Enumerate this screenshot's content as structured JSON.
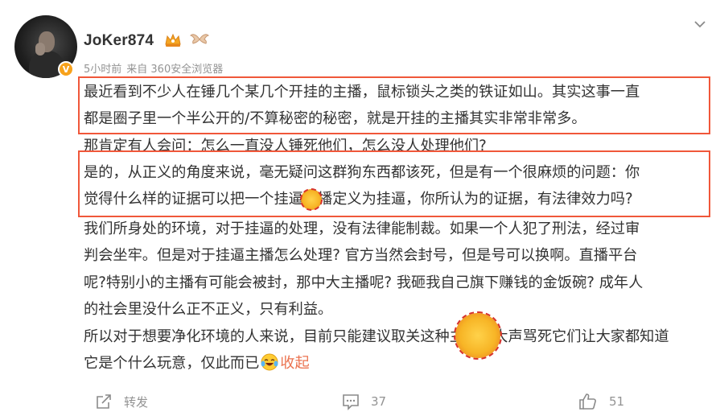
{
  "post": {
    "author": {
      "name": "JoKer874",
      "verified_badge": "V",
      "badges": [
        "crown-icon",
        "wing-icon"
      ]
    },
    "meta": {
      "time": "5小时前",
      "source": "来自 360安全浏览器"
    },
    "paragraphs": [
      "最近看到不少人在锤几个某几个开挂的主播，鼠标锁头之类的铁证如山。其实这事一直",
      "都是圈子里一个半公开的/不算秘密的秘密，就是开挂的主播其实非常非常多。",
      "那肯定有人会问：怎么一直没人锤死他们，怎么没人处理他们?",
      "是的，从正义的角度来说，毫无疑问这群狗东西都该死，但是有一个很麻烦的问题：你",
      "觉得什么样的证据可以把一个挂逼主播定义为挂逼，你所认为的证据，有法律效力吗?",
      "我们所身处的环境，对于挂逼的处理，没有法律能制裁。如果一个人犯了刑法，经过审",
      "判会坐牢。但是对于挂逼主播怎么处理?  官方当然会封号，但是号可以换啊。直播平台",
      "呢?特别小的主播有可能会被封，那中大主播呢?  我砸我自己旗下赚钱的金饭碗?  成年人",
      "的社会里没什么正不正义，只有利益。",
      "所以对于想要净化环境的人来说，目前只能建议取关这种主播并大声骂死它们让大家都知道"
    ],
    "last_line": "它是个什么玩意，仅此而已",
    "collapse_label": "收起",
    "actions": {
      "repost_label": "转发",
      "comment_count": "37",
      "like_count": "51"
    }
  },
  "colors": {
    "highlight_box": "#f0573a",
    "meta_text": "#939393",
    "body_text": "#333333",
    "collapse_link": "#eb7350",
    "verified_badge": "#f7a21c"
  }
}
